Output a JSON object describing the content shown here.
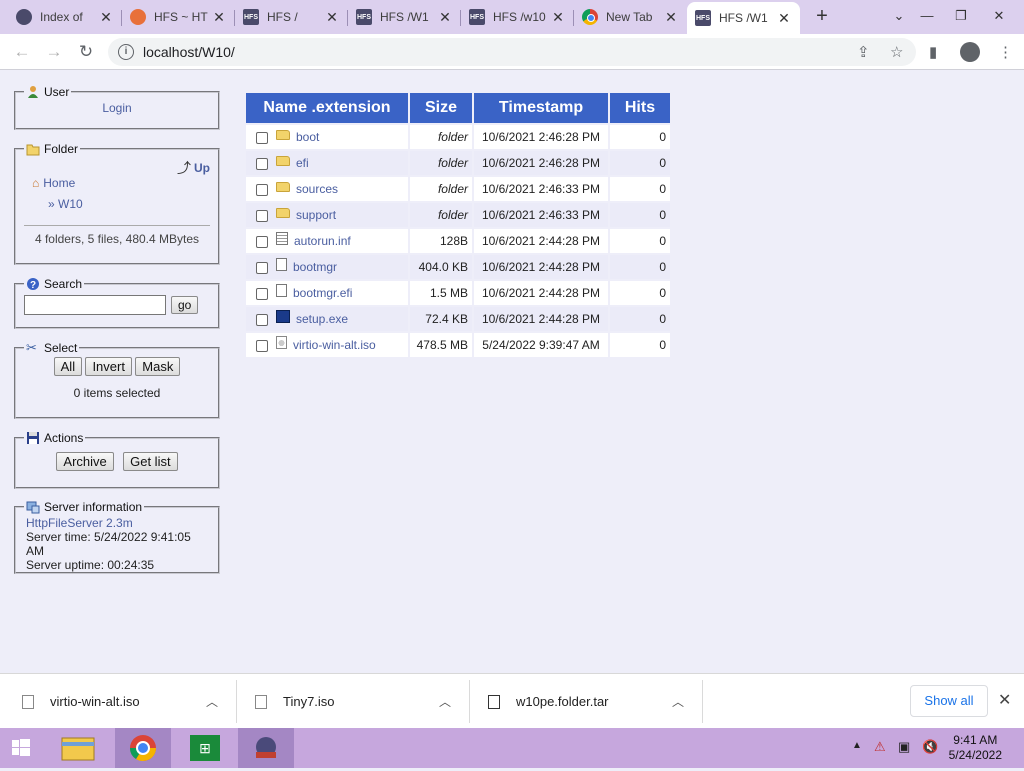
{
  "tabs": [
    {
      "label": "Index of",
      "icon": "user-favicon-icon"
    },
    {
      "label": "HFS ~ HT",
      "icon": "orange-favicon-icon"
    },
    {
      "label": "HFS /",
      "icon": "hfs-favicon-icon"
    },
    {
      "label": "HFS /W1",
      "icon": "hfs-favicon-icon"
    },
    {
      "label": "HFS /w10",
      "icon": "hfs-favicon-icon"
    },
    {
      "label": "New Tab",
      "icon": "chrome-favicon-icon"
    },
    {
      "label": "HFS /W1",
      "icon": "hfs-favicon-icon",
      "active": true
    }
  ],
  "address": {
    "url": "localhost/W10/"
  },
  "user_panel": {
    "legend": "User",
    "login": "Login"
  },
  "folder_panel": {
    "legend": "Folder",
    "up": "Up",
    "home": "Home",
    "current": "» W10",
    "summary": "4 folders, 5 files, 480.4 MBytes"
  },
  "search_panel": {
    "legend": "Search",
    "go": "go",
    "value": ""
  },
  "select_panel": {
    "legend": "Select",
    "all": "All",
    "invert": "Invert",
    "mask": "Mask",
    "status": "0 items selected"
  },
  "actions_panel": {
    "legend": "Actions",
    "archive": "Archive",
    "get_list": "Get list"
  },
  "server_panel": {
    "legend": "Server information",
    "link": "HttpFileServer 2.3m",
    "time": "Server time: 5/24/2022 9:41:05 AM",
    "uptime": "Server uptime: 00:24:35"
  },
  "table": {
    "headers": [
      "Name .extension",
      "Size",
      "Timestamp",
      "Hits"
    ],
    "rows": [
      {
        "name": "boot",
        "type": "folder",
        "size": "folder",
        "timestamp": "10/6/2021 2:46:28 PM",
        "hits": "0"
      },
      {
        "name": "efi",
        "type": "folder",
        "size": "folder",
        "timestamp": "10/6/2021 2:46:28 PM",
        "hits": "0"
      },
      {
        "name": "sources",
        "type": "folder",
        "size": "folder",
        "timestamp": "10/6/2021 2:46:33 PM",
        "hits": "0"
      },
      {
        "name": "support",
        "type": "folder",
        "size": "folder",
        "timestamp": "10/6/2021 2:46:33 PM",
        "hits": "0"
      },
      {
        "name": "autorun.inf",
        "type": "inf",
        "size": "128B",
        "timestamp": "10/6/2021 2:44:28 PM",
        "hits": "0"
      },
      {
        "name": "bootmgr",
        "type": "file",
        "size": "404.0 KB",
        "timestamp": "10/6/2021 2:44:28 PM",
        "hits": "0"
      },
      {
        "name": "bootmgr.efi",
        "type": "file",
        "size": "1.5 MB",
        "timestamp": "10/6/2021 2:44:28 PM",
        "hits": "0"
      },
      {
        "name": "setup.exe",
        "type": "exe",
        "size": "72.4 KB",
        "timestamp": "10/6/2021 2:44:28 PM",
        "hits": "0"
      },
      {
        "name": "virtio-win-alt.iso",
        "type": "iso",
        "size": "478.5 MB",
        "timestamp": "5/24/2022 9:39:47 AM",
        "hits": "0"
      }
    ]
  },
  "downloads": {
    "items": [
      "virtio-win-alt.iso",
      "Tiny7.iso",
      "w10pe.folder.tar"
    ],
    "show_all": "Show all"
  },
  "taskbar": {
    "time": "9:41 AM",
    "date": "5/24/2022"
  },
  "colors": {
    "header_blue": "#3a63c6",
    "page_bg": "#eeeef9",
    "link": "#4a5ea0",
    "taskbar": "#c6a7dd",
    "tabbar": "#dcd0ee"
  }
}
